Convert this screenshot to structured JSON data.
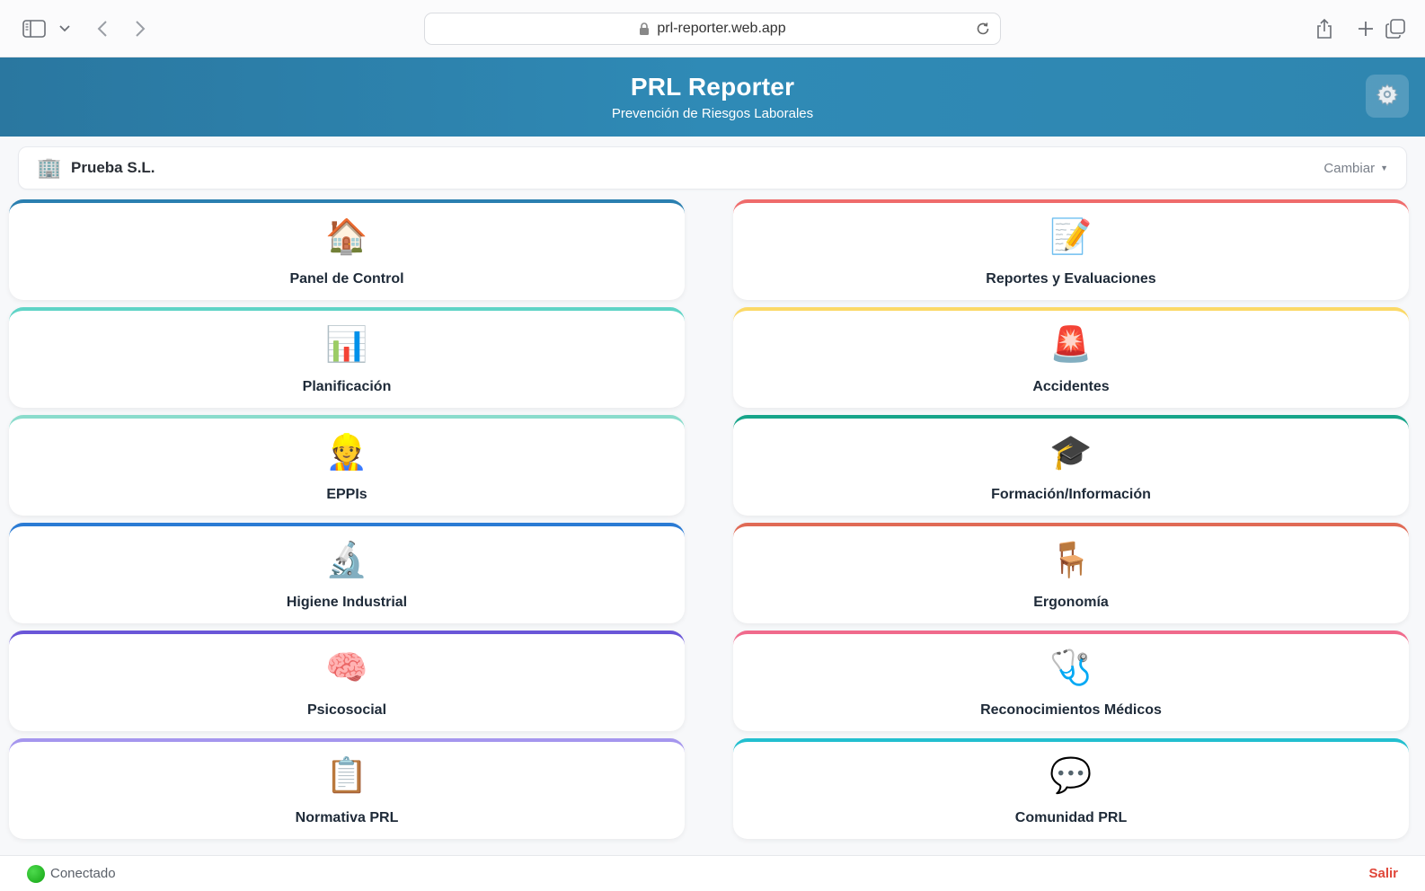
{
  "browser": {
    "url": "prl-reporter.web.app"
  },
  "header": {
    "title": "PRL Reporter",
    "subtitle": "Prevención de Riesgos Laborales"
  },
  "company": {
    "icon": "🏢",
    "name": "Prueba S.L.",
    "change_label": "Cambiar",
    "caret": "▼"
  },
  "modules": [
    {
      "label": "Panel de Control",
      "icon": "🏠",
      "accent": "#2a7fb0"
    },
    {
      "label": "Reportes y Evaluaciones",
      "icon": "📝",
      "accent": "#ef6b6b"
    },
    {
      "label": "Planificación",
      "icon": "📊",
      "accent": "#5fd4c6"
    },
    {
      "label": "Accidentes",
      "icon": "🚨",
      "accent": "#fbd966"
    },
    {
      "label": "EPPIs",
      "icon": "👷",
      "accent": "#8adccc"
    },
    {
      "label": "Formación/Información",
      "icon": "🎓",
      "accent": "#17a58a"
    },
    {
      "label": "Higiene Industrial",
      "icon": "🔬",
      "accent": "#2b7bd4"
    },
    {
      "label": "Ergonomía",
      "icon": "🪑",
      "accent": "#e06a55"
    },
    {
      "label": "Psicosocial",
      "icon": "🧠",
      "accent": "#6a56d8"
    },
    {
      "label": "Reconocimientos Médicos",
      "icon": "🩺",
      "accent": "#f06a8c"
    },
    {
      "label": "Normativa PRL",
      "icon": "📋",
      "accent": "#a596ee"
    },
    {
      "label": "Comunidad PRL",
      "icon": "💬",
      "accent": "#22bfcf"
    }
  ],
  "footer": {
    "status": "Conectado",
    "status_color": "#1fb51f",
    "logout": "Salir"
  }
}
